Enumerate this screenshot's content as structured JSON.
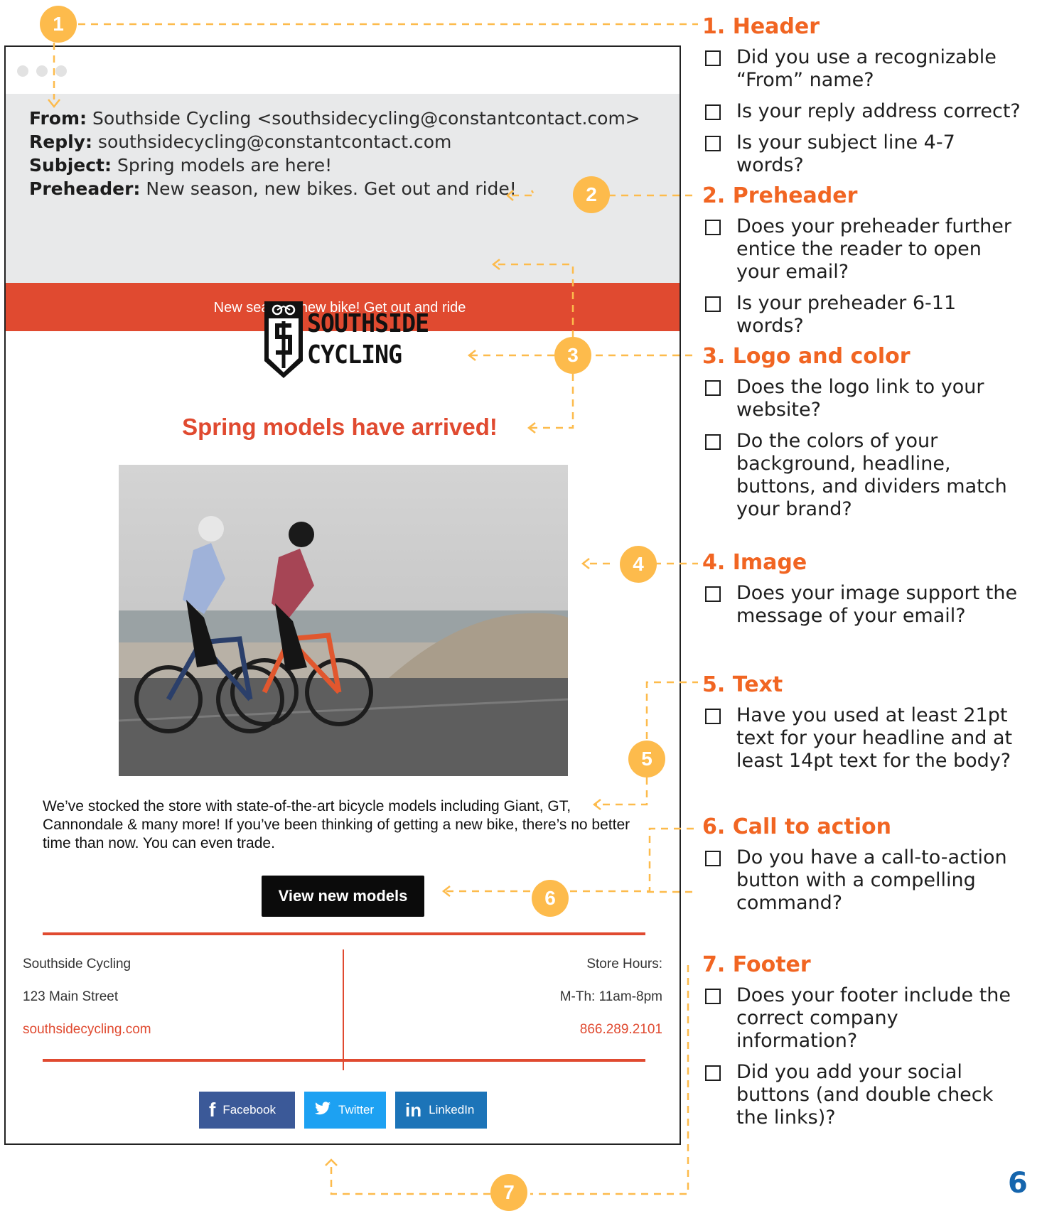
{
  "email": {
    "from_label": "From:",
    "from_value": " Southside Cycling <southsidecycling@constantcontact.com>",
    "reply_label": "Reply:",
    "reply_value": " southsidecycling@constantcontact.com",
    "subject_label": "Subject:",
    "subject_value": " Spring models are here!",
    "preheader_label": "Preheader:",
    "preheader_value": " New season, new bikes. Get out and ride!",
    "banner_text": "New season, new bike! Get out and ride",
    "logo_line1": "SOUTHSIDE",
    "logo_line2": "CYCLING",
    "headline": "Spring models have arrived!",
    "body": "We’ve stocked the store with state-of-the-art bicycle models including Giant, GT, Cannondale & many more! If you’ve been thinking of getting a new bike, there’s no better time than now. You can even trade.",
    "cta": "View new models",
    "footer": {
      "company": "Southside Cycling",
      "address": "123 Main Street",
      "website": "southsidecycling.com",
      "hours_label": "Store Hours:",
      "hours": "M-Th: 11am-8pm",
      "phone": "866.289.2101"
    },
    "social": [
      {
        "label": "Facebook",
        "icon": "facebook-icon",
        "glyph": "f"
      },
      {
        "label": "Twitter",
        "icon": "twitter-icon",
        "glyph": "🐦"
      },
      {
        "label": "LinkedIn",
        "icon": "linkedin-icon",
        "glyph": "in"
      }
    ]
  },
  "badges": [
    "1",
    "2",
    "3",
    "4",
    "5",
    "6",
    "7"
  ],
  "checklist": [
    {
      "title": "1. Header",
      "items": [
        "Did you use a recognizable “From” name?",
        "Is your reply address correct?",
        "Is your subject line 4-7 words?"
      ]
    },
    {
      "title": "2. Preheader",
      "items": [
        "Does your preheader further entice the reader to open your email?",
        "Is your preheader 6-11 words?"
      ]
    },
    {
      "title": "3. Logo and color",
      "items": [
        "Does the logo link to your website?",
        "Do the colors of your background, headline, buttons, and dividers match your brand?"
      ]
    },
    {
      "title": "4. Image",
      "items": [
        "Does your image support the message of your email?"
      ]
    },
    {
      "title": "5. Text",
      "items": [
        "Have you used at least 21pt text for your headline and at least 14pt text for the body?"
      ]
    },
    {
      "title": "6. Call to action",
      "items": [
        "Do you have a call-to-action button with a compelling command?"
      ]
    },
    {
      "title": "7. Footer",
      "items": [
        "Does your footer include the correct company information?",
        "Did you add your social buttons (and double check the links)?"
      ]
    }
  ],
  "page_number": "6",
  "colors": {
    "brand_red": "#e04a30",
    "badge": "#fdbb4c",
    "heading_orange": "#f16522",
    "page_blue": "#1565ad"
  }
}
